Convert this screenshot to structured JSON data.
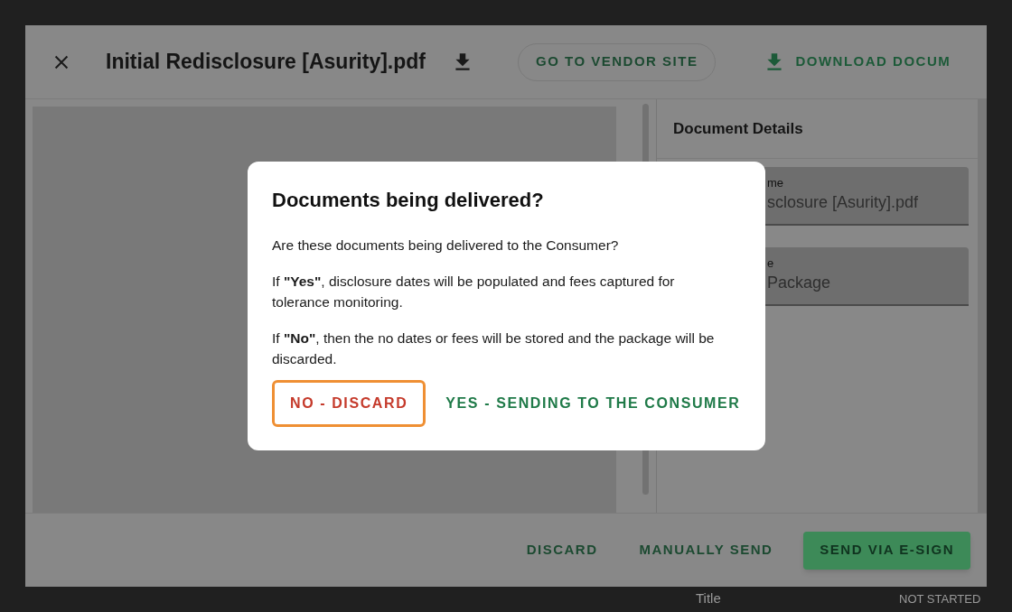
{
  "viewer": {
    "title": "Initial Redisclosure [Asurity].pdf",
    "header_actions": [
      {
        "kind": "outlined",
        "label": "GO TO VENDOR SITE"
      },
      {
        "kind": "download",
        "label": "DOWNLOAD DOCUM"
      }
    ]
  },
  "details": {
    "title": "Document Details",
    "fields": [
      {
        "label": "me",
        "value": "sclosure [Asurity].pdf"
      },
      {
        "label": "e",
        "value": "Package"
      }
    ]
  },
  "footer_buttons": [
    {
      "kind": "text",
      "label": "DISCARD"
    },
    {
      "kind": "text",
      "label": "MANUALLY SEND"
    },
    {
      "kind": "contained",
      "label": "SEND VIA E-SIGN"
    }
  ],
  "dialog": {
    "title": "Documents being delivered?",
    "paragraphs": [
      "Are these documents being delivered to the Consumer?",
      "If **\"Yes\"**, disclosure dates will be populated and fees captured for tolerance monitoring.",
      "If **\"No\"**, then the no dates or fees will be stored and the package will be discarded."
    ],
    "buttons": [
      {
        "kind": "negative",
        "label": "NO - DISCARD",
        "focused": true
      },
      {
        "kind": "positive",
        "label": "YES - SENDING TO THE CONSUMER",
        "focused": false
      }
    ]
  },
  "background": {
    "label": "Title",
    "status": "NOT STARTED"
  }
}
